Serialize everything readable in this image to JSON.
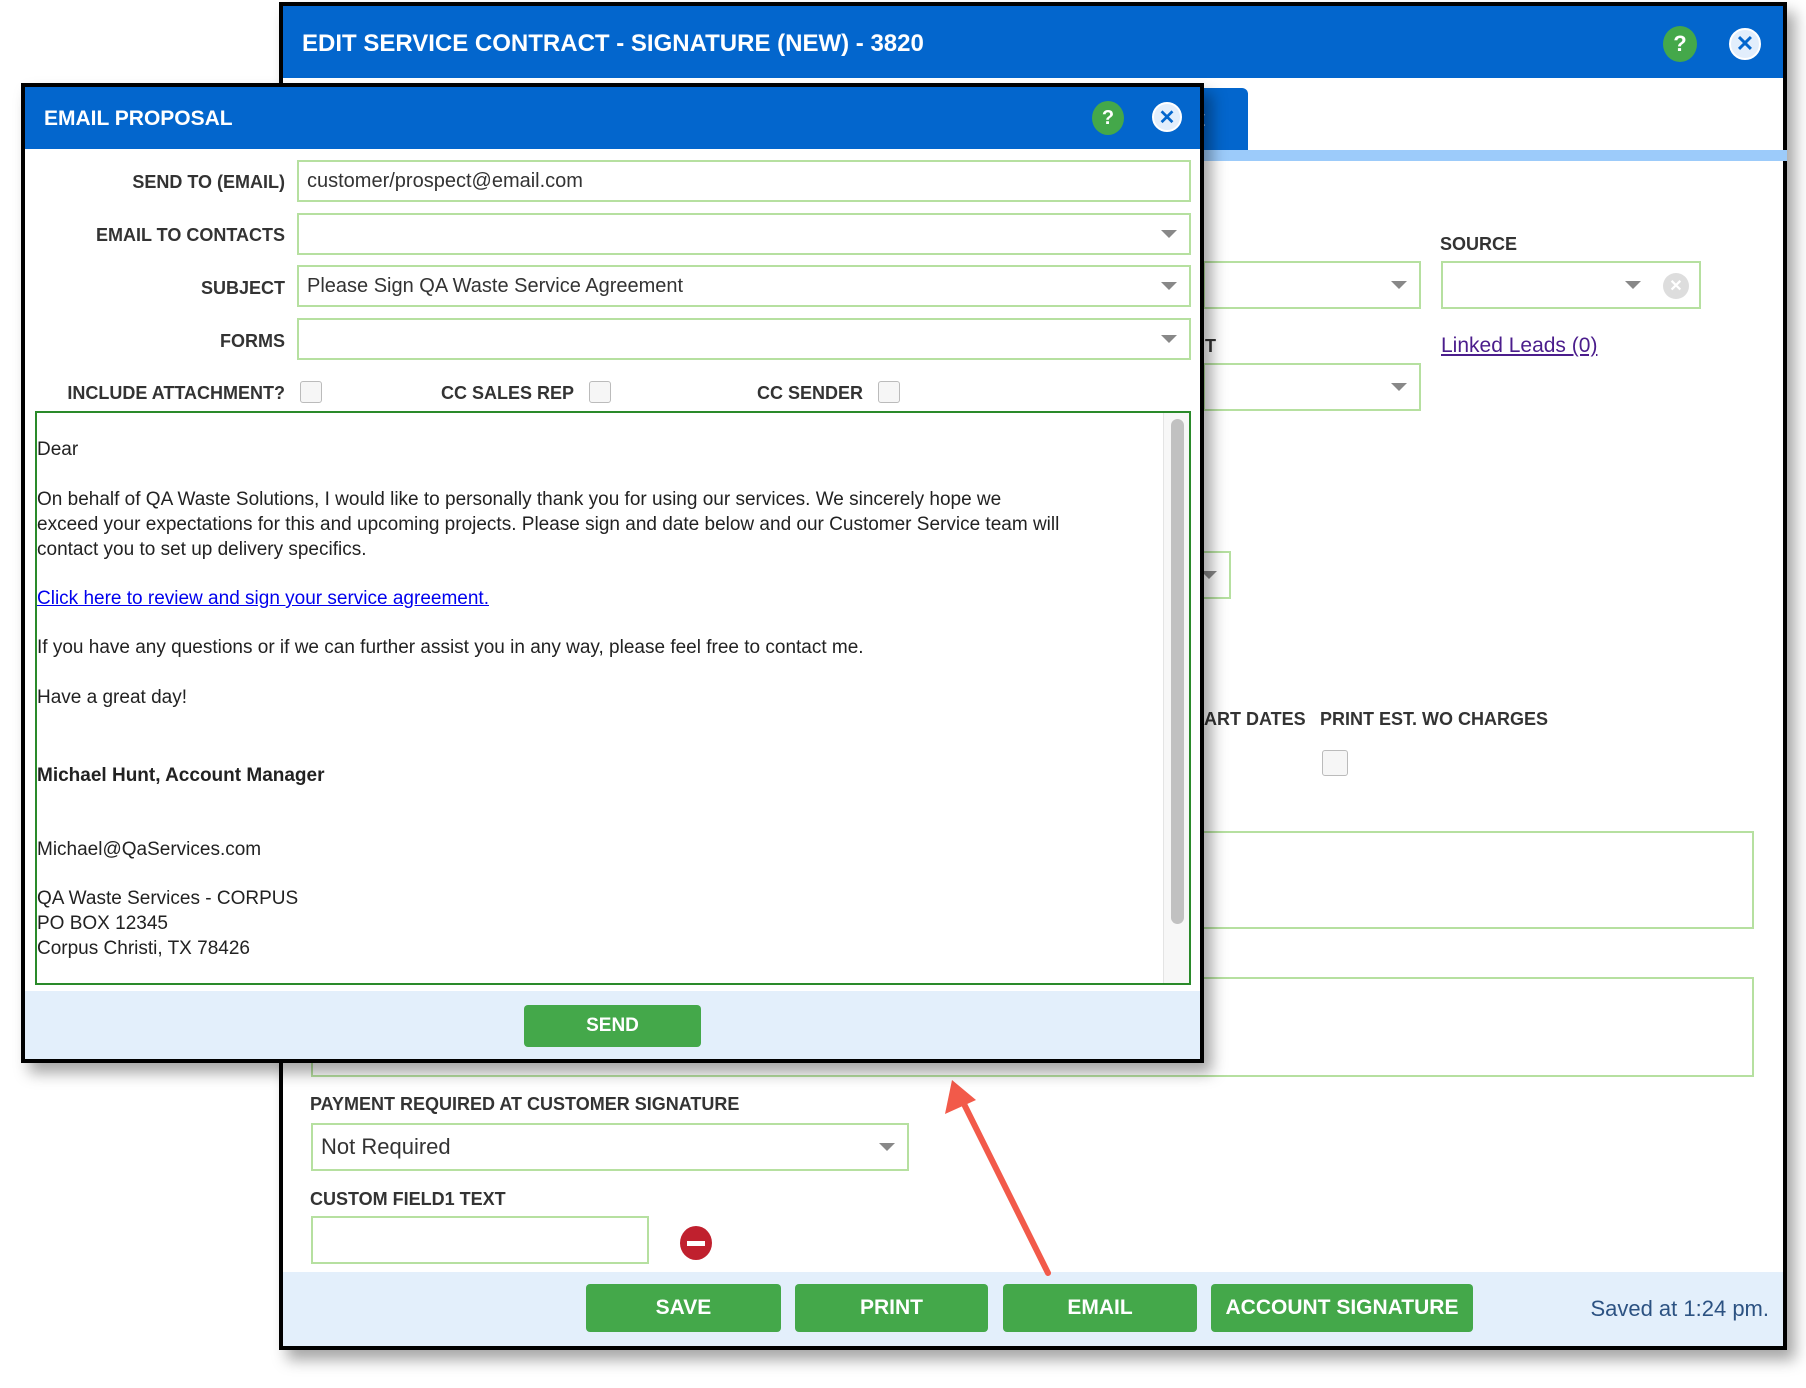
{
  "main_window": {
    "title": "EDIT SERVICE CONTRACT - SIGNATURE (NEW) - 3820",
    "tab_partial": "t",
    "source_label": "SOURCE",
    "partial_label_1": "T",
    "linked_leads": "Linked Leads (0)",
    "partial_label_2": "ART DATES",
    "print_est_label": "PRINT EST. WO CHARGES",
    "payment_label": "PAYMENT REQUIRED AT CUSTOMER SIGNATURE",
    "payment_value": "Not Required",
    "custom_field_label": "CUSTOM FIELD1 TEXT",
    "buttons": {
      "save": "SAVE",
      "print": "PRINT",
      "email": "EMAIL",
      "account_signature": "ACCOUNT SIGNATURE"
    },
    "status": "Saved at 1:24 pm.",
    "help_glyph": "?",
    "close_glyph": "✕"
  },
  "email_dialog": {
    "title": "EMAIL PROPOSAL",
    "send_to_label": "SEND TO (EMAIL)",
    "send_to_value": "customer/prospect@email.com",
    "contacts_label": "EMAIL TO CONTACTS",
    "subject_label": "SUBJECT",
    "subject_value": "Please Sign QA Waste Service Agreement",
    "forms_label": "FORMS",
    "include_attachment_label": "INCLUDE ATTACHMENT?",
    "cc_sales_rep_label": "CC SALES REP",
    "cc_sender_label": "CC SENDER",
    "body": {
      "greeting": "Dear",
      "para1_line1": "On behalf of QA Waste Solutions, I would like to personally thank you for using our services. We sincerely hope we",
      "para1_line2": "exceed your expectations for this and upcoming projects. Please sign and date below and our Customer Service team will",
      "para1_line3": "contact you to set up delivery specifics.",
      "link": "Click here to review and sign your service agreement.",
      "para2": "If you have any questions or if we can further assist you in any way, please feel free to contact me.",
      "closing": "Have a great day!",
      "signature_name": "Michael Hunt, Account Manager",
      "signature_email": "Michael@QaServices.com",
      "address_line1": "QA Waste Services - CORPUS",
      "address_line2": "PO BOX 12345",
      "address_line3": "Corpus Christi, TX 78426"
    },
    "send_label": "SEND"
  },
  "colors": {
    "header_blue": "#0366cd",
    "button_green": "#44a84a",
    "field_border": "#b6e0a0",
    "arrow": "#f25a4a",
    "footer_bg": "#e3effb"
  }
}
